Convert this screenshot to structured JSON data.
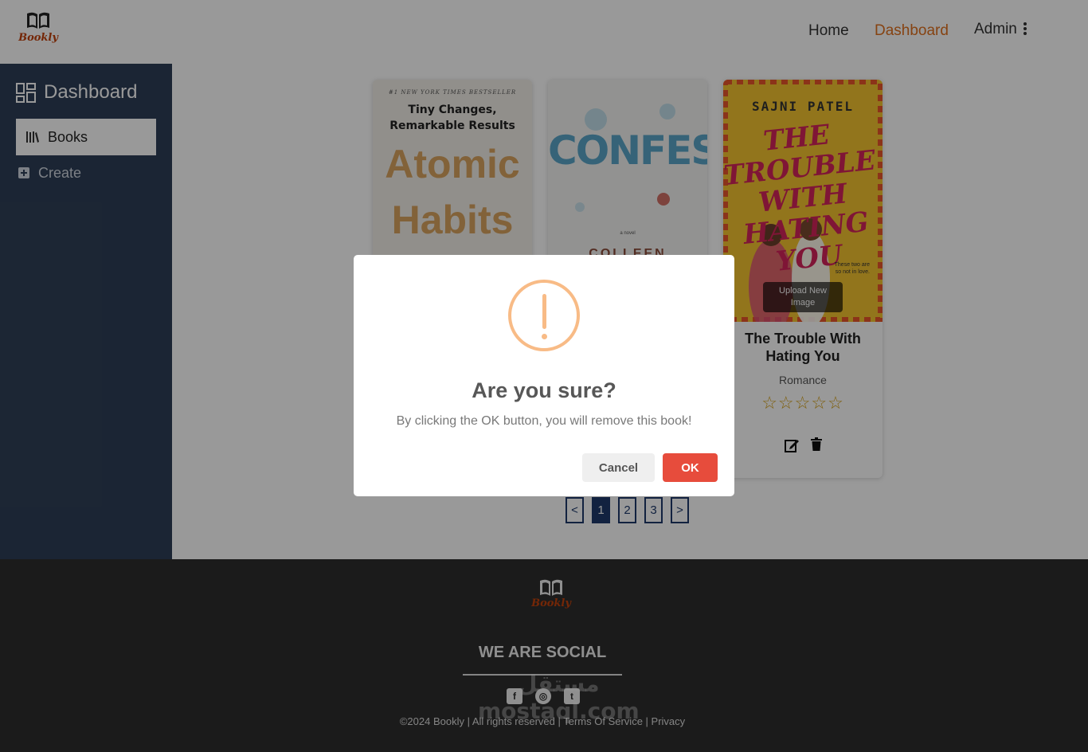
{
  "app": {
    "logo_text": "Bookly"
  },
  "nav": {
    "home": "Home",
    "dashboard": "Dashboard",
    "admin": "Admin",
    "active_color": "#e0711e"
  },
  "sidebar": {
    "title": "Dashboard",
    "items": [
      {
        "label": "Books",
        "icon": "books-icon",
        "active": true
      },
      {
        "label": "Create",
        "icon": "add-square-icon",
        "active": false
      }
    ]
  },
  "books": [
    {
      "cover": {
        "top_line": "#1 NEW YORK TIMES BESTSELLER",
        "subtitle_1": "Tiny Changes,",
        "subtitle_2": "Remarkable Results",
        "title_1": "Atomic",
        "title_2": "Habits"
      }
    },
    {
      "cover": {
        "title": "CONFESS",
        "novel": "a novel",
        "author": "COLLEEN"
      }
    },
    {
      "cover": {
        "author": "SAJNI PATEL",
        "title_1": "THE",
        "title_2": "TROUBLE",
        "title_3": "WITH",
        "title_4": "HATING",
        "title_5": "YOU",
        "tagline_1": "These two are",
        "tagline_2": "so not in love."
      },
      "upload_label_1": "Upload New",
      "upload_label_2": "Image",
      "title": "The Trouble With Hating You",
      "genre": "Romance",
      "rating": 0,
      "stars": "☆☆☆☆☆"
    }
  ],
  "pagination": {
    "prev": "<",
    "pages": [
      "1",
      "2",
      "3"
    ],
    "current": "1",
    "next": ">"
  },
  "footer": {
    "logo_text": "Bookly",
    "social_heading": "WE ARE SOCIAL",
    "icons": [
      "facebook-icon",
      "github-icon",
      "twitter-icon"
    ],
    "copyright": "©2024 Bookly | All rights reserved | Terms Of Service | Privacy",
    "watermark_1": "مستقل",
    "watermark_2": "mostaql.com"
  },
  "modal": {
    "title": "Are you sure?",
    "text": "By clicking the OK button, you will remove this book!",
    "cancel_label": "Cancel",
    "ok_label": "OK",
    "ok_color": "#e74c3c",
    "warning_color": "#f8bb86"
  }
}
